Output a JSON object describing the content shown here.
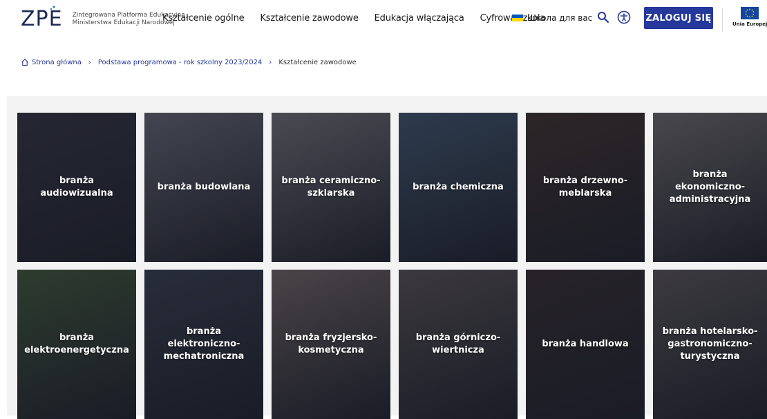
{
  "header": {
    "logo_text": "ZPE",
    "logo_line1": "Zintegrowana Platforma Edukacyjna",
    "logo_line2": "Ministerstwa Edukacji Narodowej",
    "nav": [
      "Kształcenie ogólne",
      "Kształcenie zawodowe",
      "Edukacja włączająca",
      "Cyfrowa szkoła"
    ],
    "lang_label": "Школа для вас",
    "login_label": "ZALOGUJ SIĘ",
    "eu_label": "Unia Europejska",
    "icons": {
      "search": "search-icon",
      "accessibility": "accessibility-icon",
      "home": "home-icon"
    },
    "accent_color": "#25389b"
  },
  "breadcrumb": {
    "home": "Strona główna",
    "level2": "Podstawa programowa - rok szkolny 2023/2024",
    "current": "Kształcenie zawodowe"
  },
  "tiles": [
    {
      "label": "branża audiowizualna",
      "color": "#3a3d47"
    },
    {
      "label": "branża budowlana",
      "color": "#7d8088"
    },
    {
      "label": "branża ceramiczno-szklarska",
      "color": "#8c8c8c"
    },
    {
      "label": "branża chemiczna",
      "color": "#4d6a82"
    },
    {
      "label": "branża drzewno-meblarska",
      "color": "#4a3a2e"
    },
    {
      "label": "branża ekonomiczno-administracyjna",
      "color": "#8a8580"
    },
    {
      "label": "branża elektroenergetyczna",
      "color": "#4e6b3e"
    },
    {
      "label": "branża elektroniczno-mechatroniczna",
      "color": "#3f4a55"
    },
    {
      "label": "branża fryzjersko-kosmetyczna",
      "color": "#8a7d74"
    },
    {
      "label": "branża górniczo-wiertnicza",
      "color": "#6d6560"
    },
    {
      "label": "branża handlowa",
      "color": "#3e3330"
    },
    {
      "label": "branża hotelarsko-gastronomiczno-turystyczna",
      "color": "#6e6864"
    }
  ]
}
